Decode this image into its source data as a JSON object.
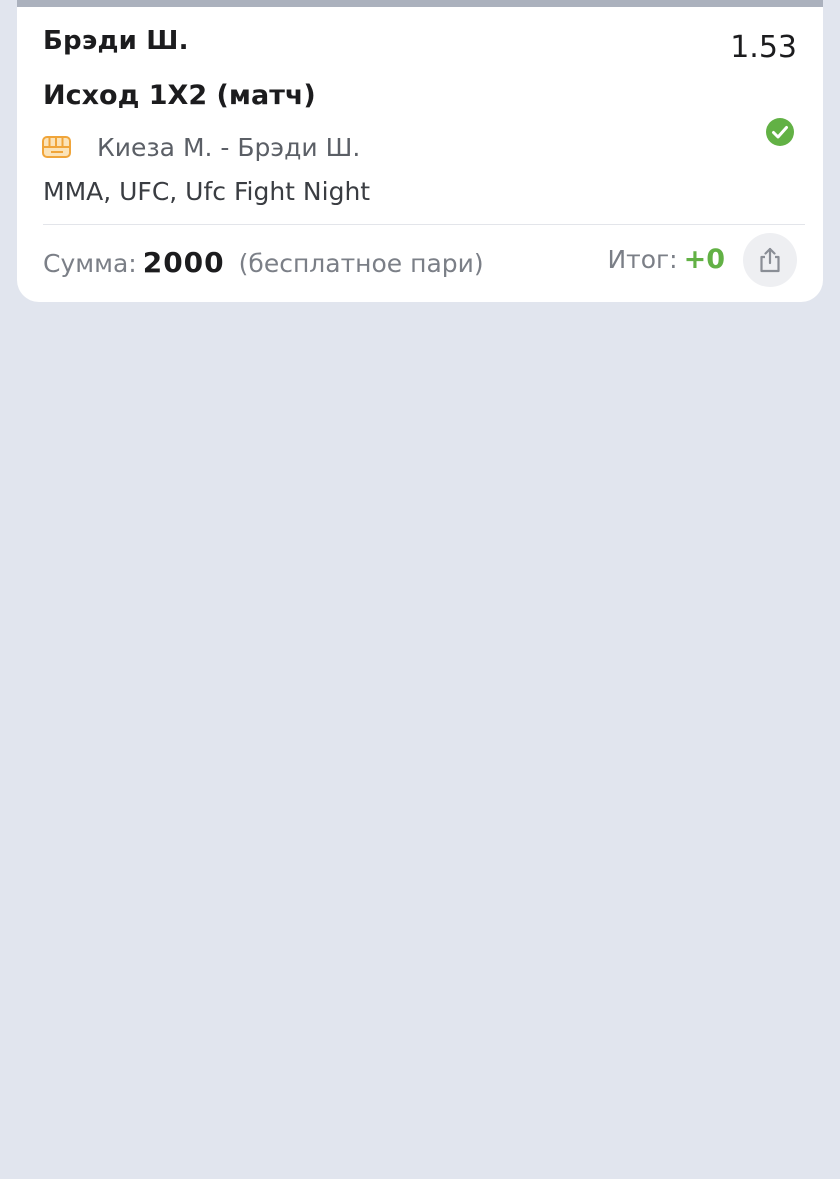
{
  "bet": {
    "selection": "Брэди Ш.",
    "odds": "1.53",
    "market": "Исход 1X2 (матч)",
    "match": "Киеза М. - Брэди Ш.",
    "tournament": "MMA, UFC, Ufc Fight Night",
    "status": "won",
    "status_icon": "check-circle-icon",
    "sport_icon": "fist-icon"
  },
  "footer": {
    "amount_label": "Сумма:",
    "amount_value": "2000",
    "freebet_note": "(бесплатное пари)",
    "result_label": "Итог:",
    "result_value": "+0",
    "share_icon": "share-icon"
  },
  "colors": {
    "background": "#e1e5ee",
    "card": "#ffffff",
    "success": "#62b145",
    "sport_icon": "#f0a53a"
  }
}
